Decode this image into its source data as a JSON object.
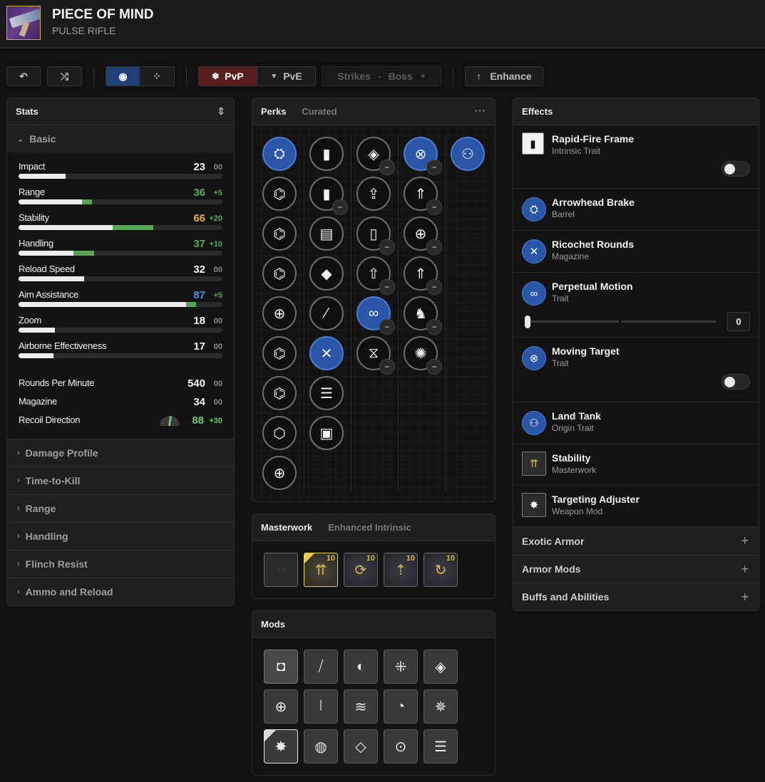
{
  "weapon": {
    "name": "PIECE OF MIND",
    "type": "PULSE RIFLE"
  },
  "toolbar": {
    "undo_icon": "↶",
    "randomize_icon": "⤮",
    "view_single_icon": "◉",
    "view_compare_icon": "⁘",
    "pvp_label": "PvP",
    "pve_label": "PvE",
    "activity": "Strikes",
    "activity_sep": "-",
    "enemy": "Boss",
    "enhance_label": "Enhance",
    "enhance_icon": "↑",
    "mode_selected": "PvP"
  },
  "stats": {
    "title": "Stats",
    "basic_label": "Basic",
    "bars": [
      {
        "name": "Impact",
        "value": "23",
        "bonus": "00",
        "base": 23,
        "added": 0,
        "color": "#f2f2f2",
        "bonus_color": "#8a8a8a"
      },
      {
        "name": "Range",
        "value": "36",
        "bonus": "+5",
        "base": 31,
        "added": 5,
        "color": "#5aa55a",
        "bonus_color": "#5aa55a"
      },
      {
        "name": "Stability",
        "value": "66",
        "bonus": "+20",
        "base": 46,
        "added": 20,
        "color": "#e6b43a",
        "bonus_color": "#5aa55a"
      },
      {
        "name": "Handling",
        "value": "37",
        "bonus": "+10",
        "base": 27,
        "added": 10,
        "color": "#5aa55a",
        "bonus_color": "#5aa55a"
      },
      {
        "name": "Reload Speed",
        "value": "32",
        "bonus": "00",
        "base": 32,
        "added": 0,
        "color": "#f2f2f2",
        "bonus_color": "#8a8a8a"
      },
      {
        "name": "Aim Assistance",
        "value": "87",
        "bonus": "+5",
        "base": 82,
        "added": 5,
        "color": "#4a8fe8",
        "bonus_color": "#5aa55a"
      },
      {
        "name": "Zoom",
        "value": "18",
        "bonus": "00",
        "base": 18,
        "added": 0,
        "color": "#f2f2f2",
        "bonus_color": "#8a8a8a"
      },
      {
        "name": "Airborne Effectiveness",
        "value": "17",
        "bonus": "00",
        "base": 17,
        "added": 0,
        "color": "#f2f2f2",
        "bonus_color": "#8a8a8a"
      }
    ],
    "plain": [
      {
        "name": "Rounds Per Minute",
        "value": "540",
        "bonus": "00"
      },
      {
        "name": "Magazine",
        "value": "34",
        "bonus": "00"
      }
    ],
    "recoil": {
      "name": "Recoil Direction",
      "value": "88",
      "bonus": "+30"
    },
    "sections": [
      "Damage Profile",
      "Time-to-Kill",
      "Range",
      "Handling",
      "Flinch Resist",
      "Ammo and Reload"
    ]
  },
  "perks": {
    "title": "Perks",
    "tab2": "Curated",
    "more_icon": "···",
    "columns": [
      [
        {
          "name": "Arrowhead Brake",
          "glyph": "⛭",
          "selected": true
        },
        {
          "name": "barrel-2",
          "glyph": "⌬",
          "selected": false
        },
        {
          "name": "barrel-3",
          "glyph": "⌬",
          "selected": false
        },
        {
          "name": "barrel-4",
          "glyph": "⌬",
          "selected": false
        },
        {
          "name": "barrel-5",
          "glyph": "⊕",
          "selected": false
        },
        {
          "name": "barrel-6",
          "glyph": "⌬",
          "selected": false
        },
        {
          "name": "barrel-7",
          "glyph": "⌬",
          "selected": false
        },
        {
          "name": "barrel-8",
          "glyph": "⬡",
          "selected": false
        },
        {
          "name": "barrel-9",
          "glyph": "⊕",
          "selected": false
        }
      ],
      [
        {
          "name": "mag-1",
          "glyph": "▮",
          "selected": false
        },
        {
          "name": "mag-2",
          "glyph": "▮",
          "selected": false,
          "minus": true
        },
        {
          "name": "mag-3",
          "glyph": "▤",
          "selected": false
        },
        {
          "name": "mag-4",
          "glyph": "◆",
          "selected": false
        },
        {
          "name": "mag-5",
          "glyph": "⁄",
          "selected": false
        },
        {
          "name": "Ricochet Rounds",
          "glyph": "✕",
          "selected": true
        },
        {
          "name": "mag-7",
          "glyph": "☰",
          "selected": false
        },
        {
          "name": "mag-8",
          "glyph": "▣",
          "selected": false
        }
      ],
      [
        {
          "name": "trait1-1",
          "glyph": "◈",
          "selected": false,
          "minus": true
        },
        {
          "name": "trait1-2",
          "glyph": "⇪",
          "selected": false
        },
        {
          "name": "trait1-3",
          "glyph": "▯",
          "selected": false,
          "minus": true
        },
        {
          "name": "trait1-4",
          "glyph": "⇧",
          "selected": false,
          "minus": true
        },
        {
          "name": "Perpetual Motion",
          "glyph": "∞",
          "selected": true,
          "minus": true
        },
        {
          "name": "trait1-6",
          "glyph": "⧖",
          "selected": false,
          "minus": true
        }
      ],
      [
        {
          "name": "Moving Target",
          "glyph": "⊗",
          "selected": true,
          "minus": true
        },
        {
          "name": "trait2-2",
          "glyph": "⇑",
          "selected": false,
          "minus": true
        },
        {
          "name": "trait2-3",
          "glyph": "⊕",
          "selected": false,
          "minus": true
        },
        {
          "name": "trait2-4",
          "glyph": "⇑",
          "selected": false,
          "minus": true
        },
        {
          "name": "trait2-5",
          "glyph": "♞",
          "selected": false,
          "minus": true
        },
        {
          "name": "trait2-6",
          "glyph": "✺",
          "selected": false,
          "minus": true
        }
      ],
      [
        {
          "name": "Land Tank",
          "glyph": "⚇",
          "selected": true
        }
      ]
    ]
  },
  "masterwork": {
    "tab1": "Masterwork",
    "tab2": "Enhanced Intrinsic",
    "items": [
      {
        "name": "empty",
        "glyph": "◌",
        "level": "",
        "selected": false,
        "empty": true
      },
      {
        "name": "Stability",
        "glyph": "⇈",
        "level": "10",
        "selected": true
      },
      {
        "name": "Handling",
        "glyph": "⟳",
        "level": "10",
        "selected": false
      },
      {
        "name": "Range",
        "glyph": "⇡",
        "level": "10",
        "selected": false
      },
      {
        "name": "Reload Speed",
        "glyph": "↻",
        "level": "10",
        "selected": false
      }
    ]
  },
  "mods": {
    "title": "Mods",
    "items": [
      {
        "glyph": "◘",
        "state": "current"
      },
      {
        "glyph": "⧸",
        "state": ""
      },
      {
        "glyph": "◐",
        "state": ""
      },
      {
        "glyph": "⁜",
        "state": ""
      },
      {
        "glyph": "◈",
        "state": ""
      },
      {
        "glyph": "⊕",
        "state": ""
      },
      {
        "glyph": "⦚",
        "state": ""
      },
      {
        "glyph": "≋",
        "state": ""
      },
      {
        "glyph": "◔",
        "state": ""
      },
      {
        "glyph": "✵",
        "state": ""
      },
      {
        "glyph": "✸",
        "state": "selected"
      },
      {
        "glyph": "◍",
        "state": ""
      },
      {
        "glyph": "◇",
        "state": ""
      },
      {
        "glyph": "⊙",
        "state": ""
      },
      {
        "glyph": "☰",
        "state": ""
      }
    ]
  },
  "effects": {
    "title": "Effects",
    "items": [
      {
        "name": "Rapid-Fire Frame",
        "type": "Intrinsic Trait",
        "glyph": "▮",
        "toggle": false
      },
      {
        "name": "Arrowhead Brake",
        "type": "Barrel",
        "glyph": "⛭"
      },
      {
        "name": "Ricochet Rounds",
        "type": "Magazine",
        "glyph": "✕"
      },
      {
        "name": "Perpetual Motion",
        "type": "Trait",
        "glyph": "∞",
        "slider_value": "0",
        "slider_fraction": 0
      },
      {
        "name": "Moving Target",
        "type": "Trait",
        "glyph": "⊗",
        "toggle": false
      },
      {
        "name": "Land Tank",
        "type": "Origin Trait",
        "glyph": "⚇"
      },
      {
        "name": "Stability",
        "type": "Masterwork",
        "glyph": "⇈"
      },
      {
        "name": "Targeting Adjuster",
        "type": "Weapon Mod",
        "glyph": "✸"
      }
    ],
    "add_sections": [
      "Exotic Armor",
      "Armor Mods",
      "Buffs and Abilities"
    ],
    "plus_icon": "+"
  }
}
